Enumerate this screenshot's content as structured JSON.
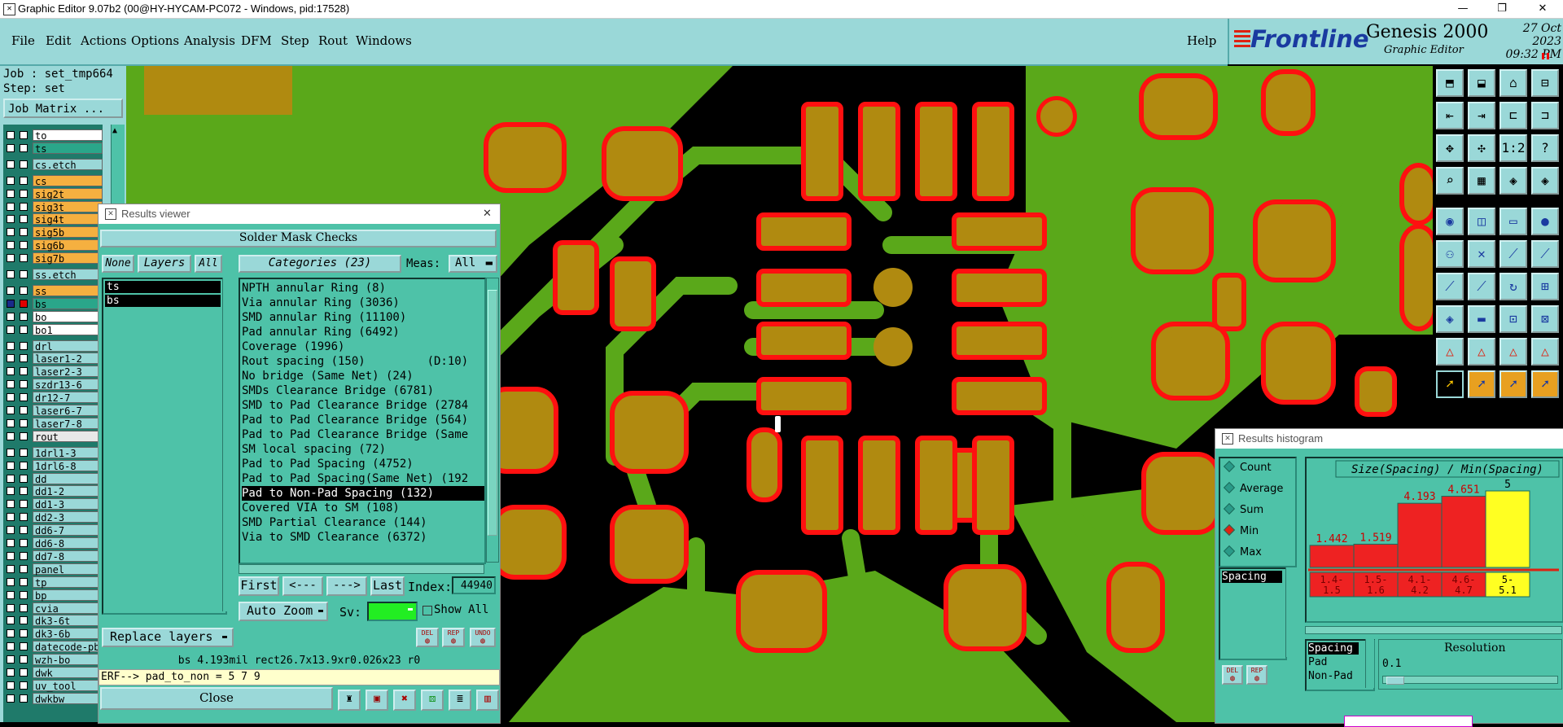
{
  "window": {
    "title": "Graphic Editor 9.07b2 (00@HY-HYCAM-PC072 - Windows, pid:17528)",
    "min": "—",
    "max": "❐",
    "close": "✕"
  },
  "menu": {
    "items": [
      "File",
      "Edit",
      "Actions",
      "Options",
      "Analysis",
      "DFM",
      "Step",
      "Rout",
      "Windows"
    ],
    "help": "Help"
  },
  "brand": {
    "logo": "Frontline",
    "product": "Genesis 2000",
    "subtitle": "Graphic Editor",
    "date": "27 Oct 2023",
    "time": "09:32 PM"
  },
  "job": {
    "job_line": "Job : set_tmp664",
    "step_line": "Step: set",
    "matrix_button": "Job Matrix ..."
  },
  "layers": [
    {
      "name": "to",
      "color": "#ffffff",
      "b2": "#fff"
    },
    {
      "name": "ts",
      "color": "#2aa68a",
      "b2": "#fff"
    },
    {
      "name": "cs.etch",
      "color": "#9ad8d8",
      "b2": "#fff",
      "gap": true
    },
    {
      "name": "cs",
      "color": "#f5b040",
      "b2": "#fff",
      "gap": true
    },
    {
      "name": "sig2t",
      "color": "#f5b040",
      "b2": "#fff"
    },
    {
      "name": "sig3t",
      "color": "#f5b040",
      "b2": "#fff"
    },
    {
      "name": "sig4t",
      "color": "#f5b040",
      "b2": "#fff"
    },
    {
      "name": "sig5b",
      "color": "#f5b040",
      "b2": "#fff"
    },
    {
      "name": "sig6b",
      "color": "#f5b040",
      "b2": "#fff"
    },
    {
      "name": "sig7b",
      "color": "#f5b040",
      "b2": "#fff"
    },
    {
      "name": "ss.etch",
      "color": "#9ad8d8",
      "b2": "#fff",
      "gap": true
    },
    {
      "name": "ss",
      "color": "#f5b040",
      "b2": "#fff",
      "gap": true
    },
    {
      "name": "bs",
      "color": "#2aa68a",
      "b2": "#e00000",
      "b1": "#1a2a8a"
    },
    {
      "name": "bo",
      "color": "#ffffff",
      "b2": "#fff"
    },
    {
      "name": "bo1",
      "color": "#ffffff",
      "b2": "#fff"
    },
    {
      "name": "drl",
      "color": "#9ad8d8",
      "b2": "#fff",
      "gap": true
    },
    {
      "name": "laser1-2",
      "color": "#9ad8d8",
      "b2": "#fff"
    },
    {
      "name": "laser2-3",
      "color": "#9ad8d8",
      "b2": "#fff"
    },
    {
      "name": "szdr13-6",
      "color": "#9ad8d8",
      "b2": "#fff"
    },
    {
      "name": "dr12-7",
      "color": "#9ad8d8",
      "b2": "#fff"
    },
    {
      "name": "laser6-7",
      "color": "#9ad8d8",
      "b2": "#fff"
    },
    {
      "name": "laser7-8",
      "color": "#9ad8d8",
      "b2": "#fff"
    },
    {
      "name": "rout",
      "color": "#e8e8e8",
      "b2": "#fff"
    },
    {
      "name": "1drl1-3",
      "color": "#9ad8d8",
      "b2": "#fff",
      "gap": true
    },
    {
      "name": "1drl6-8",
      "color": "#9ad8d8",
      "b2": "#fff"
    },
    {
      "name": "dd",
      "color": "#9ad8d8",
      "b2": "#fff"
    },
    {
      "name": "dd1-2",
      "color": "#9ad8d8",
      "b2": "#fff"
    },
    {
      "name": "dd1-3",
      "color": "#9ad8d8",
      "b2": "#fff"
    },
    {
      "name": "dd2-3",
      "color": "#9ad8d8",
      "b2": "#fff"
    },
    {
      "name": "dd6-7",
      "color": "#9ad8d8",
      "b2": "#fff"
    },
    {
      "name": "dd6-8",
      "color": "#9ad8d8",
      "b2": "#fff"
    },
    {
      "name": "dd7-8",
      "color": "#9ad8d8",
      "b2": "#fff"
    },
    {
      "name": "panel",
      "color": "#9ad8d8",
      "b2": "#fff"
    },
    {
      "name": "tp",
      "color": "#9ad8d8",
      "b2": "#fff"
    },
    {
      "name": "bp",
      "color": "#9ad8d8",
      "b2": "#fff"
    },
    {
      "name": "cvia",
      "color": "#9ad8d8",
      "b2": "#fff"
    },
    {
      "name": "dk3-6t",
      "color": "#9ad8d8",
      "b2": "#fff"
    },
    {
      "name": "dk3-6b",
      "color": "#9ad8d8",
      "b2": "#fff"
    },
    {
      "name": "datecode-pb",
      "color": "#9ad8d8",
      "b2": "#fff"
    },
    {
      "name": "wzh-bo",
      "color": "#9ad8d8",
      "b2": "#fff"
    },
    {
      "name": "dwk",
      "color": "#9ad8d8",
      "b2": "#fff"
    },
    {
      "name": "uv_tool",
      "color": "#9ad8d8",
      "b2": "#fff"
    },
    {
      "name": "dwkbw",
      "color": "#9ad8d8",
      "b2": "#fff"
    }
  ],
  "results_viewer": {
    "title": "Results viewer",
    "header": "Solder Mask Checks",
    "none": "None",
    "layers": "Layers",
    "all": "All",
    "categories_label": "Categories (23)",
    "meas_label": "Meas:",
    "meas_value": "All",
    "layer_list": [
      "ts",
      "bs"
    ],
    "categories": [
      "NPTH annular Ring (8)",
      "Via annular Ring (3036)",
      "SMD annular Ring (11100)",
      "Pad annular Ring (6492)",
      "Coverage (1996)",
      "Rout spacing (150)         (D:10)",
      "No bridge (Same Net) (24)",
      "SMDs Clearance Bridge (6781)",
      "SMD to Pad Clearance Bridge (2784",
      "Pad to Pad Clearance Bridge (564)",
      "Pad to Pad Clearance Bridge (Same",
      "SM local spacing (72)",
      "Pad to Pad Spacing (4752)",
      "Pad to Pad Spacing(Same Net) (192",
      "Pad to Non-Pad Spacing (132)",
      "Covered VIA to SM (108)",
      "SMD Partial Clearance (144)",
      "Via to SMD Clearance (6372)"
    ],
    "selected_index": 14,
    "nav": {
      "first": "First",
      "prev": "<---",
      "next": "--->",
      "last": "Last",
      "index_label": "Index:",
      "index_value": "44940"
    },
    "auto_zoom": "Auto Zoom",
    "sv_label": "Sv:",
    "show_all": "Show All",
    "replace_layers": "Replace layers",
    "small_buttons": [
      "DEL",
      "REP",
      "UNDO"
    ],
    "info_line": "bs 4.193mil  rect26.7x13.9xr0.026x23  r0",
    "erf_line": "ERF--> pad_to_non = 5 7 9",
    "close": "Close"
  },
  "histogram": {
    "title": "Results histogram",
    "modes": [
      "Count",
      "Average",
      "Sum",
      "Min",
      "Max"
    ],
    "selected_mode": "Min",
    "list": [
      "Spacing"
    ],
    "chart_title": "Size(Spacing) / Min(Spacing)",
    "bottom_list": [
      "Spacing",
      "Pad",
      "Non-Pad"
    ],
    "resolution_label": "Resolution",
    "resolution_value": "0.1",
    "small_buttons": [
      "DEL",
      "REP"
    ]
  },
  "chart_data": {
    "type": "bar",
    "title": "Size(Spacing) / Min(Spacing)",
    "categories": [
      "1.4-1.5",
      "1.5-1.6",
      "4.1-4.2",
      "4.6-4.7",
      "5-5.1"
    ],
    "category_lines": [
      [
        "1.4-",
        "1.5"
      ],
      [
        "1.5-",
        "1.6"
      ],
      [
        "4.1-",
        "4.2"
      ],
      [
        "4.6-",
        "4.7"
      ],
      [
        "5-",
        "5.1"
      ]
    ],
    "values": [
      1.442,
      1.519,
      4.193,
      4.651,
      5
    ],
    "value_labels": [
      "1.442",
      "1.519",
      "4.193",
      "4.651",
      "5"
    ],
    "colors": [
      "#ee2222",
      "#ee2222",
      "#ee2222",
      "#ee2222",
      "#ffff22"
    ],
    "ylim": [
      0,
      5
    ]
  },
  "colors": {
    "panel": "#9ad8d8",
    "teal": "#4ec2a8",
    "copper": "#b08a10",
    "mask": "#ff1010",
    "board": "#5aa81a"
  }
}
